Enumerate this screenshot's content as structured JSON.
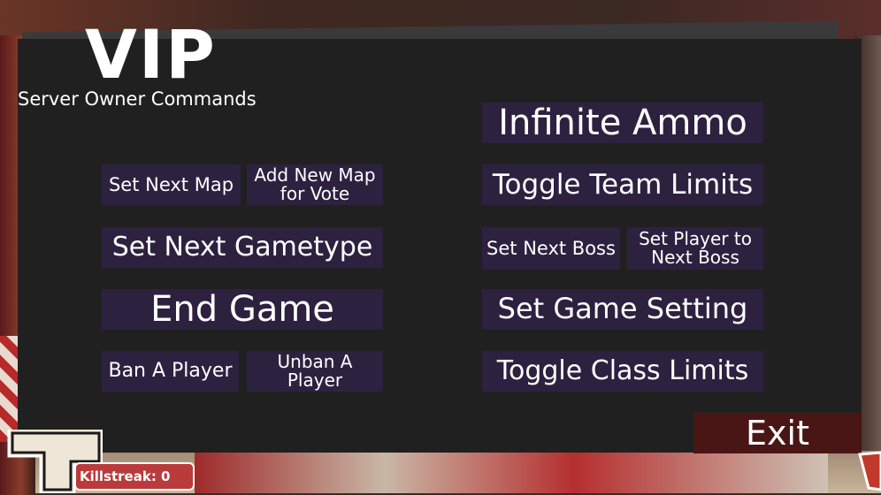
{
  "header": {
    "title": "VIP",
    "subtitle": "Server Owner Commands"
  },
  "left_column": {
    "set_next_map": "Set Next Map",
    "add_new_map_for_vote": "Add New Map\nfor Vote",
    "set_next_gametype": "Set Next Gametype",
    "end_game": "End Game",
    "ban_a_player": "Ban A Player",
    "unban_a_player": "Unban A\nPlayer"
  },
  "right_column": {
    "infinite_ammo": "Infinite Ammo",
    "toggle_team_limits": "Toggle Team Limits",
    "set_next_boss": "Set Next Boss",
    "set_player_to_next_boss": "Set Player to\nNext Boss",
    "set_game_setting": "Set Game Setting",
    "toggle_class_limits": "Toggle Class Limits"
  },
  "exit_label": "Exit",
  "hud": {
    "killstreak": "Killstreak: 0"
  },
  "colors": {
    "panel": "#202020",
    "button": "#2d2140",
    "exit_button": "#4a1515",
    "killstreak_badge": "#b93b3b"
  }
}
